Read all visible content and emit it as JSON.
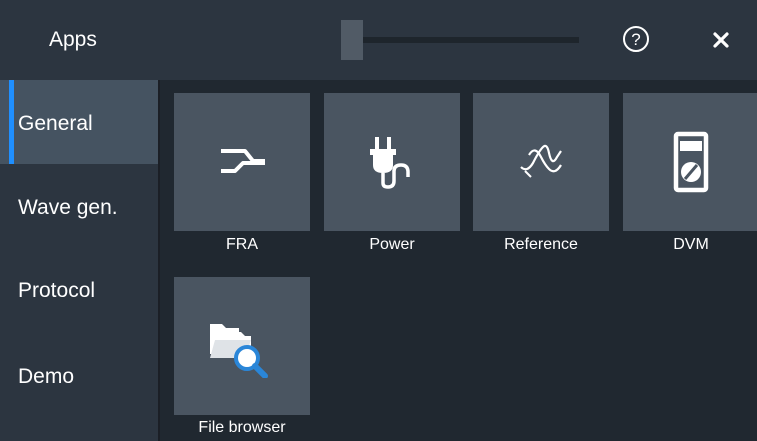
{
  "header": {
    "title": "Apps",
    "slider_label": "",
    "help_icon": "help-circle-icon",
    "close_icon": "close-icon"
  },
  "sidebar": {
    "items": [
      {
        "label": "General",
        "active": true
      },
      {
        "label": "Wave gen.",
        "active": false
      },
      {
        "label": "Protocol",
        "active": false
      },
      {
        "label": "Demo",
        "active": false
      }
    ]
  },
  "apps": [
    {
      "label": "FRA",
      "icon": "fra-icon"
    },
    {
      "label": "Power",
      "icon": "power-plug-icon"
    },
    {
      "label": "Reference",
      "icon": "reference-waveform-icon"
    },
    {
      "label": "DVM",
      "icon": "multimeter-icon"
    },
    {
      "label": "File browser",
      "icon": "file-browser-icon"
    }
  ],
  "colors": {
    "accent": "#1f8fff",
    "header_bg": "#2c3540",
    "tile_bg": "#4a5561",
    "active_tab_bg": "#455361"
  }
}
